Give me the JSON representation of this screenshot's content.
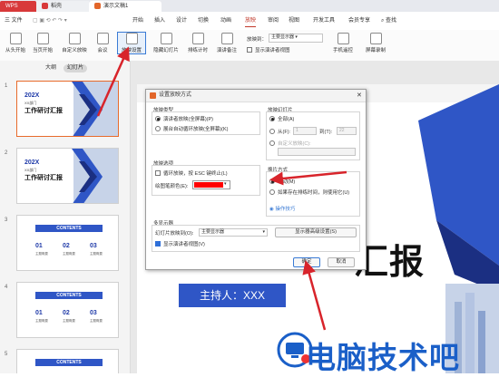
{
  "app_tabs": [
    {
      "label": "WPS"
    },
    {
      "label": "稻壳"
    },
    {
      "label": "演示文稿1"
    }
  ],
  "menu": {
    "file": "三 文件",
    "items": [
      "开始",
      "插入",
      "设计",
      "切换",
      "动画",
      "放映",
      "审阅",
      "视图",
      "开发工具",
      "会员专享"
    ],
    "active": "放映",
    "search": "查找"
  },
  "ribbon": {
    "buttons": [
      "从头开始",
      "当页开始",
      "自定义放映",
      "会议",
      "放映设置",
      "隐藏幻灯片",
      "排练计时",
      "演讲备注"
    ],
    "display_to_label": "放映到：",
    "display_to_value": "主要显示器",
    "presenter_view": "显示演讲者视图",
    "phone_remote": "手机遥控",
    "screen_record": "屏幕录制"
  },
  "left_panel": {
    "view_tabs": [
      "大纲",
      "幻灯片"
    ],
    "active_view": "幻灯片",
    "slides": [
      {
        "num": "1",
        "year": "202X",
        "dept": "XX部门",
        "title": "工作研讨汇报"
      },
      {
        "num": "2",
        "year": "202X",
        "dept": "XX部门",
        "title": "工作研讨汇报"
      },
      {
        "num": "3",
        "contents": "CONTENTS",
        "items": [
          {
            "n": "01",
            "t": "主题概要"
          },
          {
            "n": "02",
            "t": "主题概要"
          },
          {
            "n": "03",
            "t": "主题概要"
          }
        ]
      },
      {
        "num": "4",
        "contents": "CONTENTS",
        "items": [
          {
            "n": "01",
            "t": "主题概要"
          },
          {
            "n": "02",
            "t": "主题概要"
          },
          {
            "n": "03",
            "t": "主题概要"
          }
        ]
      },
      {
        "num": "5",
        "contents": "CONTENTS"
      }
    ]
  },
  "slide": {
    "title": "汇报",
    "host": "主持人：XXX"
  },
  "dialog": {
    "title": "设置放映方式",
    "show_type": {
      "label": "放映类型",
      "options": [
        "演讲者放映(全屏幕)(P)",
        "展台自动循环放映(全屏幕)(K)"
      ],
      "selected": 0
    },
    "show_slides": {
      "label": "放映幻灯片",
      "all": "全部(A)",
      "from": "从(F):",
      "from_value": "1",
      "to": "到(T):",
      "to_value": "22",
      "custom": "自定义放映(C):"
    },
    "show_options": {
      "label": "放映选项",
      "loop": "循环放映，按 ESC 键终止(L)",
      "pen_color": "绘图笔颜色(E):",
      "pen_color_hex": "#ff0000"
    },
    "advance": {
      "label": "换片方式",
      "manual": "手动(M)",
      "timings": "如果存在排练时间，则使用它(U)",
      "help": "操作技巧"
    },
    "multi_monitor": {
      "label": "多显示器",
      "show_on": "幻灯片放映到(O):",
      "monitor_value": "主要显示器",
      "advanced": "显示器高级设置(S)",
      "presenter_view": "显示演讲者视图(V)"
    },
    "ok": "确定",
    "cancel": "取消"
  },
  "watermark": {
    "text": "电脑技术吧"
  },
  "colors": {
    "accent": "#c1392b",
    "brand_blue": "#2f56c6",
    "annotation_red": "#d8242b",
    "selection": "#e86b2b"
  }
}
